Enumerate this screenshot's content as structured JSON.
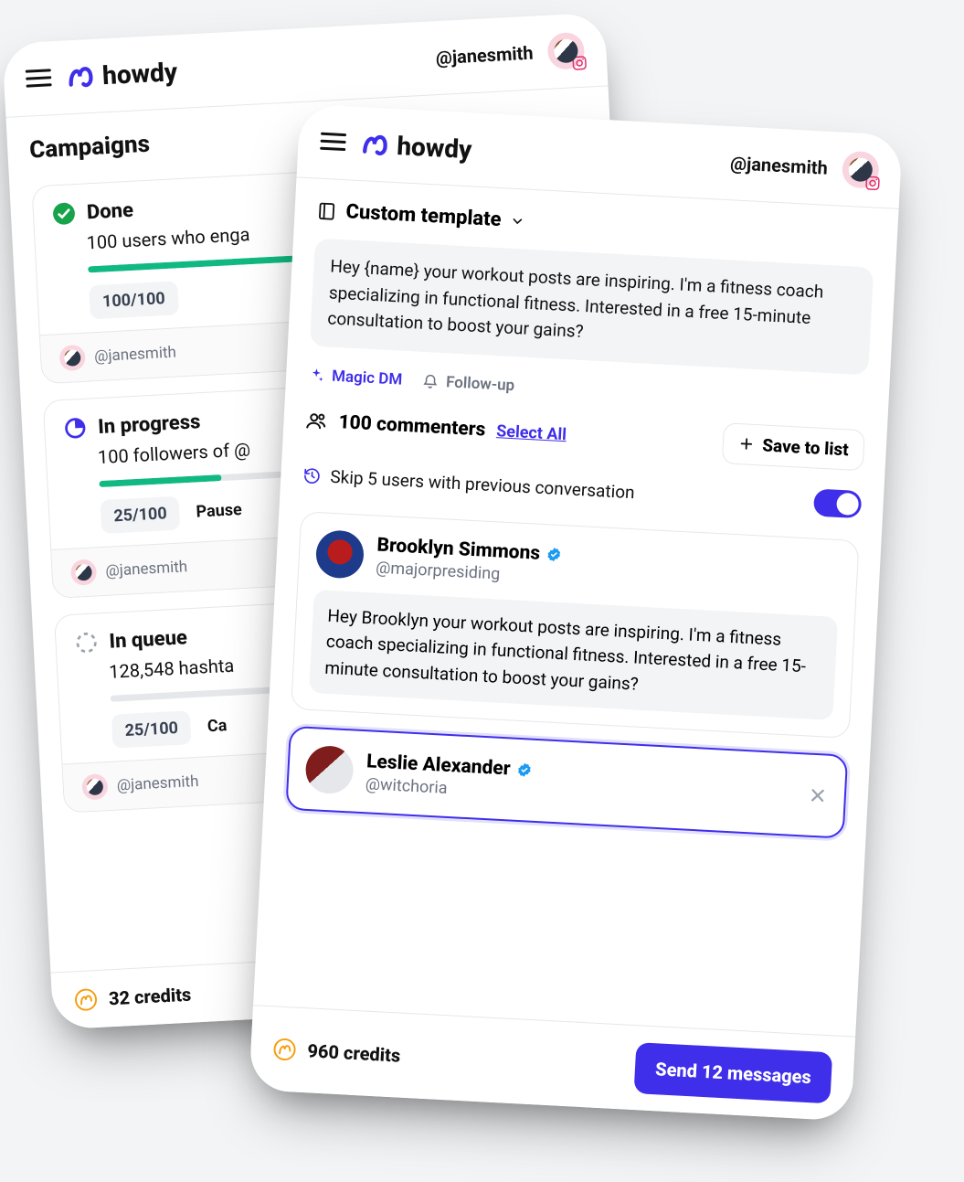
{
  "brand": "howdy",
  "user_handle": "@janesmith",
  "back": {
    "page_title": "Campaigns",
    "credits_label": "32 credits",
    "campaigns": [
      {
        "status": "Done",
        "desc": "100 users who enga",
        "count": "100/100",
        "progress_pct": 100,
        "action": "",
        "by": "@janesmith"
      },
      {
        "status": "In progress",
        "desc": "100 followers of @",
        "count": "25/100",
        "progress_pct": 25,
        "action": "Pause",
        "by": "@janesmith"
      },
      {
        "status": "In queue",
        "desc": "128,548 hashta",
        "count": "25/100",
        "progress_pct": 0,
        "action": "Ca",
        "by": "@janesmith"
      }
    ]
  },
  "front": {
    "template_label": "Custom template",
    "template_body": "Hey {name} your workout posts are inspiring. I'm a fitness coach specializing in functional fitness. Interested in a free 15-minute consultation to boost your gains?",
    "magic_dm": "Magic DM",
    "follow_up": "Follow-up",
    "commenters_count": "100 commenters",
    "select_all": "Select All",
    "save_to_list": "Save to list",
    "skip_label": "Skip 5 users with previous conversation",
    "skip_on": true,
    "users": [
      {
        "name": "Brooklyn Simmons",
        "handle": "@majorpresiding",
        "msg": "Hey Brooklyn your workout posts are inspiring. I'm a fitness coach specializing in functional fitness. Interested in a free 15-minute consultation to boost your gains?",
        "selected": false
      },
      {
        "name": "Leslie Alexander",
        "handle": "@witchoria",
        "msg": "",
        "selected": true
      }
    ],
    "credits_label": "960 credits",
    "send_label": "Send 12 messages"
  }
}
